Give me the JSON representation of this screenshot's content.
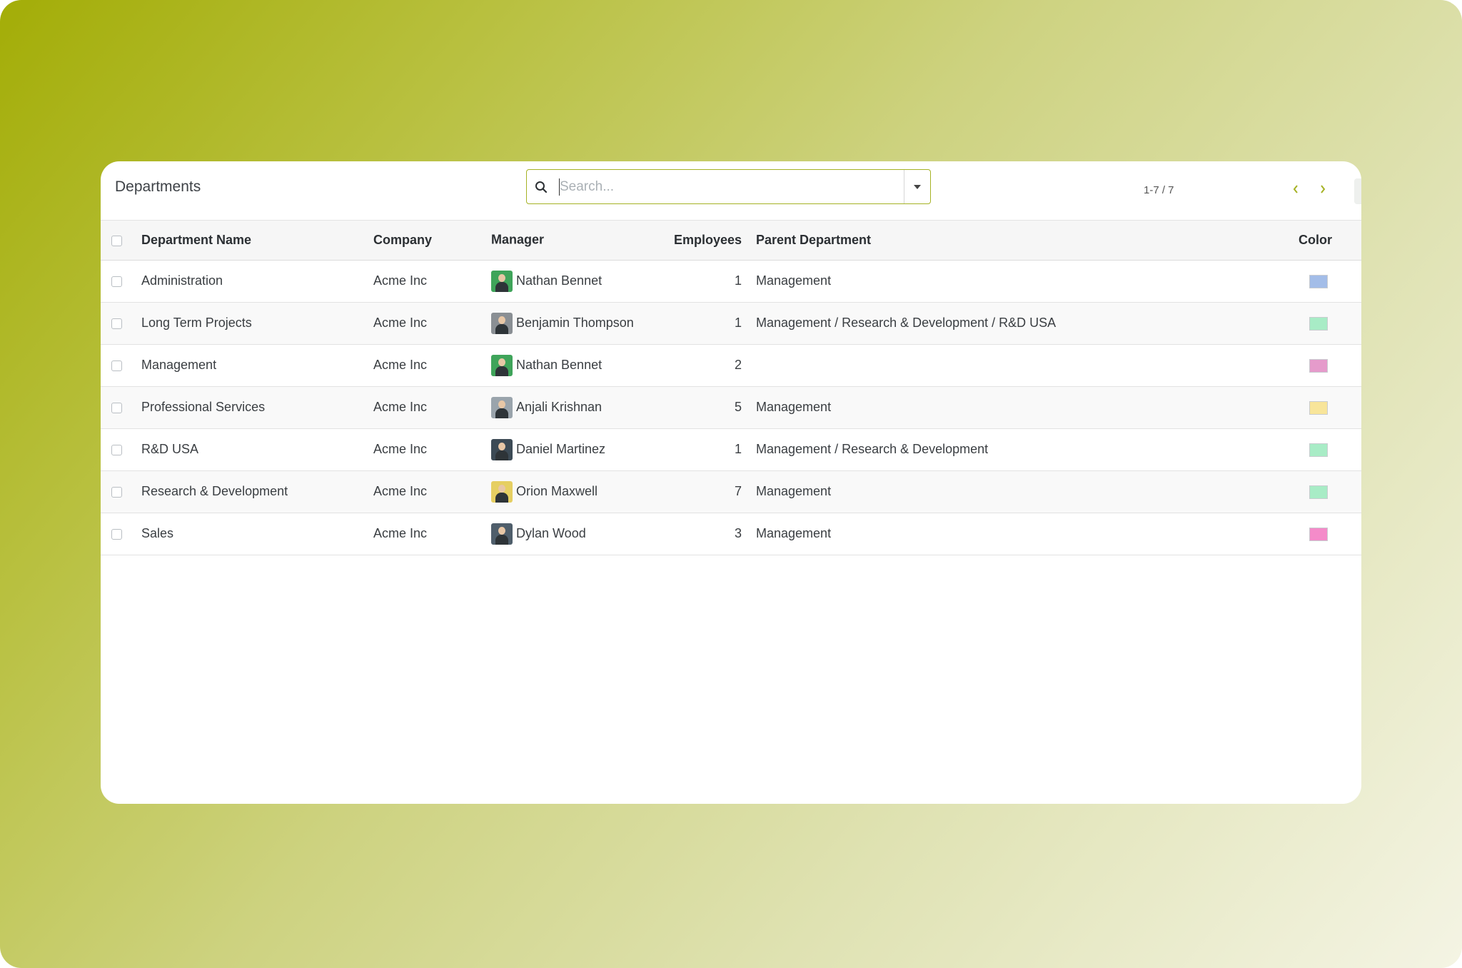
{
  "app": {
    "title": "Departments",
    "search_placeholder": "Search...",
    "pager_text": "1-7 / 7",
    "accent_color": "#a5b224"
  },
  "icons": {
    "search": "search-icon",
    "dropdown": "caret-down-icon",
    "prev": "chevron-left-icon",
    "next": "chevron-right-icon",
    "list_view": "list-view-icon",
    "graph_view": "bar-chart-icon",
    "hierarchy_view": "hierarchy-icon"
  },
  "table": {
    "headers": {
      "name": "Department Name",
      "company": "Company",
      "manager": "Manager",
      "employees": "Employees",
      "parent": "Parent Department",
      "color": "Color"
    },
    "rows": [
      {
        "name": "Administration",
        "company": "Acme Inc",
        "manager": "Nathan Bennet",
        "employees": "1",
        "parent": "Management",
        "color": "#a3bde8",
        "avatar_bg": "#3fa45a"
      },
      {
        "name": "Long Term Projects",
        "company": "Acme Inc",
        "manager": "Benjamin Thompson",
        "employees": "1",
        "parent": "Management / Research & Development / R&D USA",
        "color": "#a8ecc6",
        "avatar_bg": "#8a8f94"
      },
      {
        "name": "Management",
        "company": "Acme Inc",
        "manager": "Nathan Bennet",
        "employees": "2",
        "parent": "",
        "color": "#e59bcb",
        "avatar_bg": "#3fa45a"
      },
      {
        "name": "Professional Services",
        "company": "Acme Inc",
        "manager": "Anjali Krishnan",
        "employees": "5",
        "parent": "Management",
        "color": "#f8e59a",
        "avatar_bg": "#9aa4ac"
      },
      {
        "name": "R&D USA",
        "company": "Acme Inc",
        "manager": "Daniel Martinez",
        "employees": "1",
        "parent": "Management / Research & Development",
        "color": "#a8ecc6",
        "avatar_bg": "#3c4a55"
      },
      {
        "name": "Research & Development",
        "company": "Acme Inc",
        "manager": "Orion Maxwell",
        "employees": "7",
        "parent": "Management",
        "color": "#a8ecc6",
        "avatar_bg": "#e6cf62"
      },
      {
        "name": "Sales",
        "company": "Acme Inc",
        "manager": "Dylan Wood",
        "employees": "3",
        "parent": "Management",
        "color": "#f48bc9",
        "avatar_bg": "#4f5e6b"
      }
    ]
  }
}
